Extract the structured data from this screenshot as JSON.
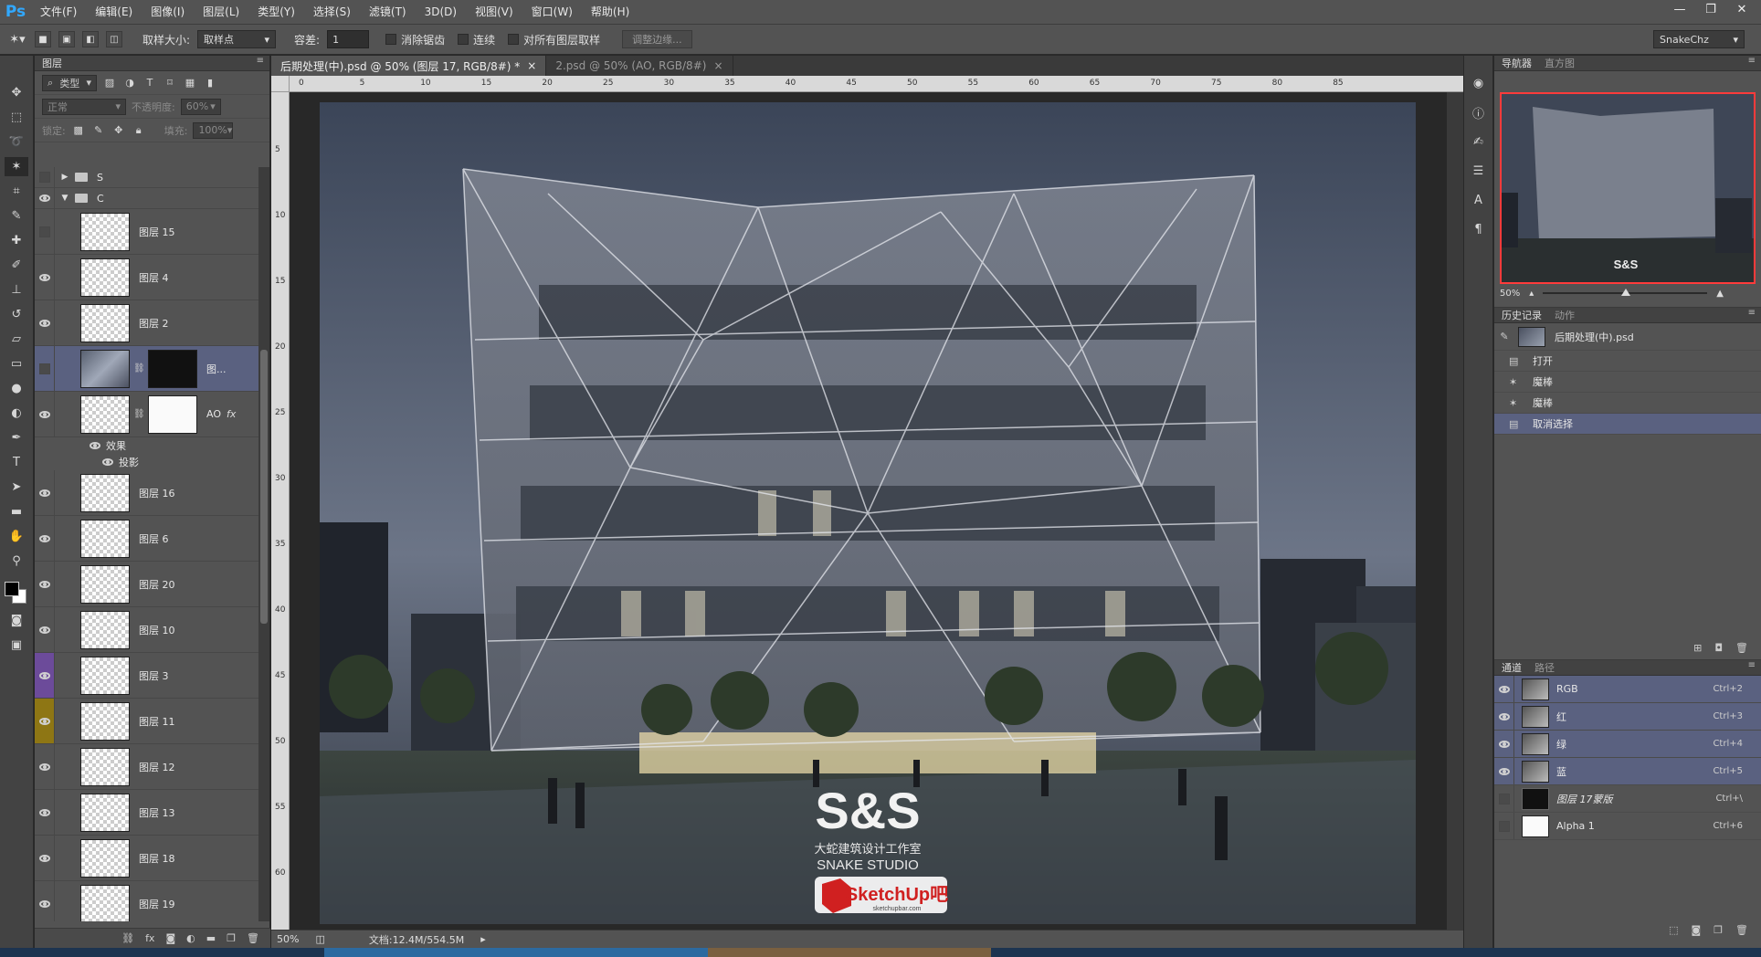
{
  "app": {
    "logo": "Ps",
    "menu": [
      "文件(F)",
      "编辑(E)",
      "图像(I)",
      "图层(L)",
      "类型(Y)",
      "选择(S)",
      "滤镜(T)",
      "3D(D)",
      "视图(V)",
      "窗口(W)",
      "帮助(H)"
    ],
    "window_controls": [
      "—",
      "❐",
      "✕"
    ]
  },
  "options": {
    "sample_size_label": "取样大小:",
    "sample_size_value": "取样点",
    "tolerance_label": "容差:",
    "tolerance_value": "1",
    "anti_alias_label": "消除锯齿",
    "contiguous_label": "连续",
    "all_layers_label": "对所有图层取样",
    "refine_edge_label": "调整边缘...",
    "workspace_value": "SnakeChz"
  },
  "layers": {
    "tab_label": "图层",
    "kind_filter": "类型",
    "blend_mode": "正常",
    "opacity_label": "不透明度:",
    "opacity_value": "60%",
    "lock_label": "锁定:",
    "fill_label": "填充:",
    "fill_value": "100%",
    "groups": [
      {
        "name": "S",
        "visible": false,
        "expanded": false
      },
      {
        "name": "C",
        "visible": true,
        "expanded": true
      }
    ],
    "items": [
      {
        "name": "图层 15",
        "visible": false
      },
      {
        "name": "图层 4",
        "visible": true
      },
      {
        "name": "图层 2",
        "visible": true
      },
      {
        "name": "图...",
        "visible": false,
        "has_mask": true,
        "active": true
      },
      {
        "name": "AO",
        "visible": true,
        "has_mask": true,
        "fx": "fx"
      },
      {
        "name": "图层 16",
        "visible": true
      },
      {
        "name": "图层 6",
        "visible": true
      },
      {
        "name": "图层 20",
        "visible": true
      },
      {
        "name": "图层 10",
        "visible": true
      },
      {
        "name": "图层 3",
        "visible": true,
        "color": "purple"
      },
      {
        "name": "图层 11",
        "visible": true,
        "color": "gold"
      },
      {
        "name": "图层 12",
        "visible": true
      },
      {
        "name": "图层 13",
        "visible": true
      },
      {
        "name": "图层 18",
        "visible": true
      },
      {
        "name": "图层 19",
        "visible": true
      }
    ],
    "effects_label": "效果",
    "shadow_label": "投影"
  },
  "document": {
    "tabs": [
      {
        "label": "后期处理(中).psd @ 50% (图层 17, RGB/8#) *",
        "active": true
      },
      {
        "label": "2.psd @ 50% (AO, RGB/8#)",
        "active": false
      }
    ],
    "ruler_ticks": [
      "0",
      "5",
      "10",
      "15",
      "20",
      "25",
      "30",
      "35",
      "40",
      "45",
      "50",
      "55",
      "60",
      "65",
      "70",
      "75",
      "80",
      "85"
    ],
    "ruler_v_ticks": [
      "5",
      "10",
      "15",
      "20",
      "25",
      "30",
      "35",
      "40",
      "45",
      "50",
      "55",
      "60"
    ],
    "zoom": "50%",
    "doc_size": "文档:12.4M/554.5M",
    "watermark_title": "S&S",
    "watermark_cn": "大蛇建筑设计工作室",
    "watermark_en": "SNAKE STUDIO",
    "watermark_brand": "SketchUp吧",
    "watermark_url": "sketchupbar.com"
  },
  "navigator": {
    "tab_label": "导航器",
    "tab2_label": "直方图",
    "zoom": "50%",
    "thumb_title": "S&S"
  },
  "history": {
    "tab_label": "历史记录",
    "tab2_label": "动作",
    "snapshot": "后期处理(中).psd",
    "steps": [
      "打开",
      "魔棒",
      "魔棒",
      "取消选择"
    ]
  },
  "channels": {
    "tab_label": "通道",
    "tab2_label": "路径",
    "items": [
      {
        "name": "RGB",
        "shortcut": "Ctrl+2"
      },
      {
        "name": "红",
        "shortcut": "Ctrl+3"
      },
      {
        "name": "绿",
        "shortcut": "Ctrl+4"
      },
      {
        "name": "蓝",
        "shortcut": "Ctrl+5"
      },
      {
        "name": "图层 17蒙版",
        "shortcut": "Ctrl+\\"
      },
      {
        "name": "Alpha 1",
        "shortcut": "Ctrl+6"
      }
    ]
  },
  "colors": {
    "ui_dark": "#535353",
    "selection": "#5a6180",
    "nav_frame": "#ff3b3b",
    "ps_blue": "#31a8ff"
  }
}
